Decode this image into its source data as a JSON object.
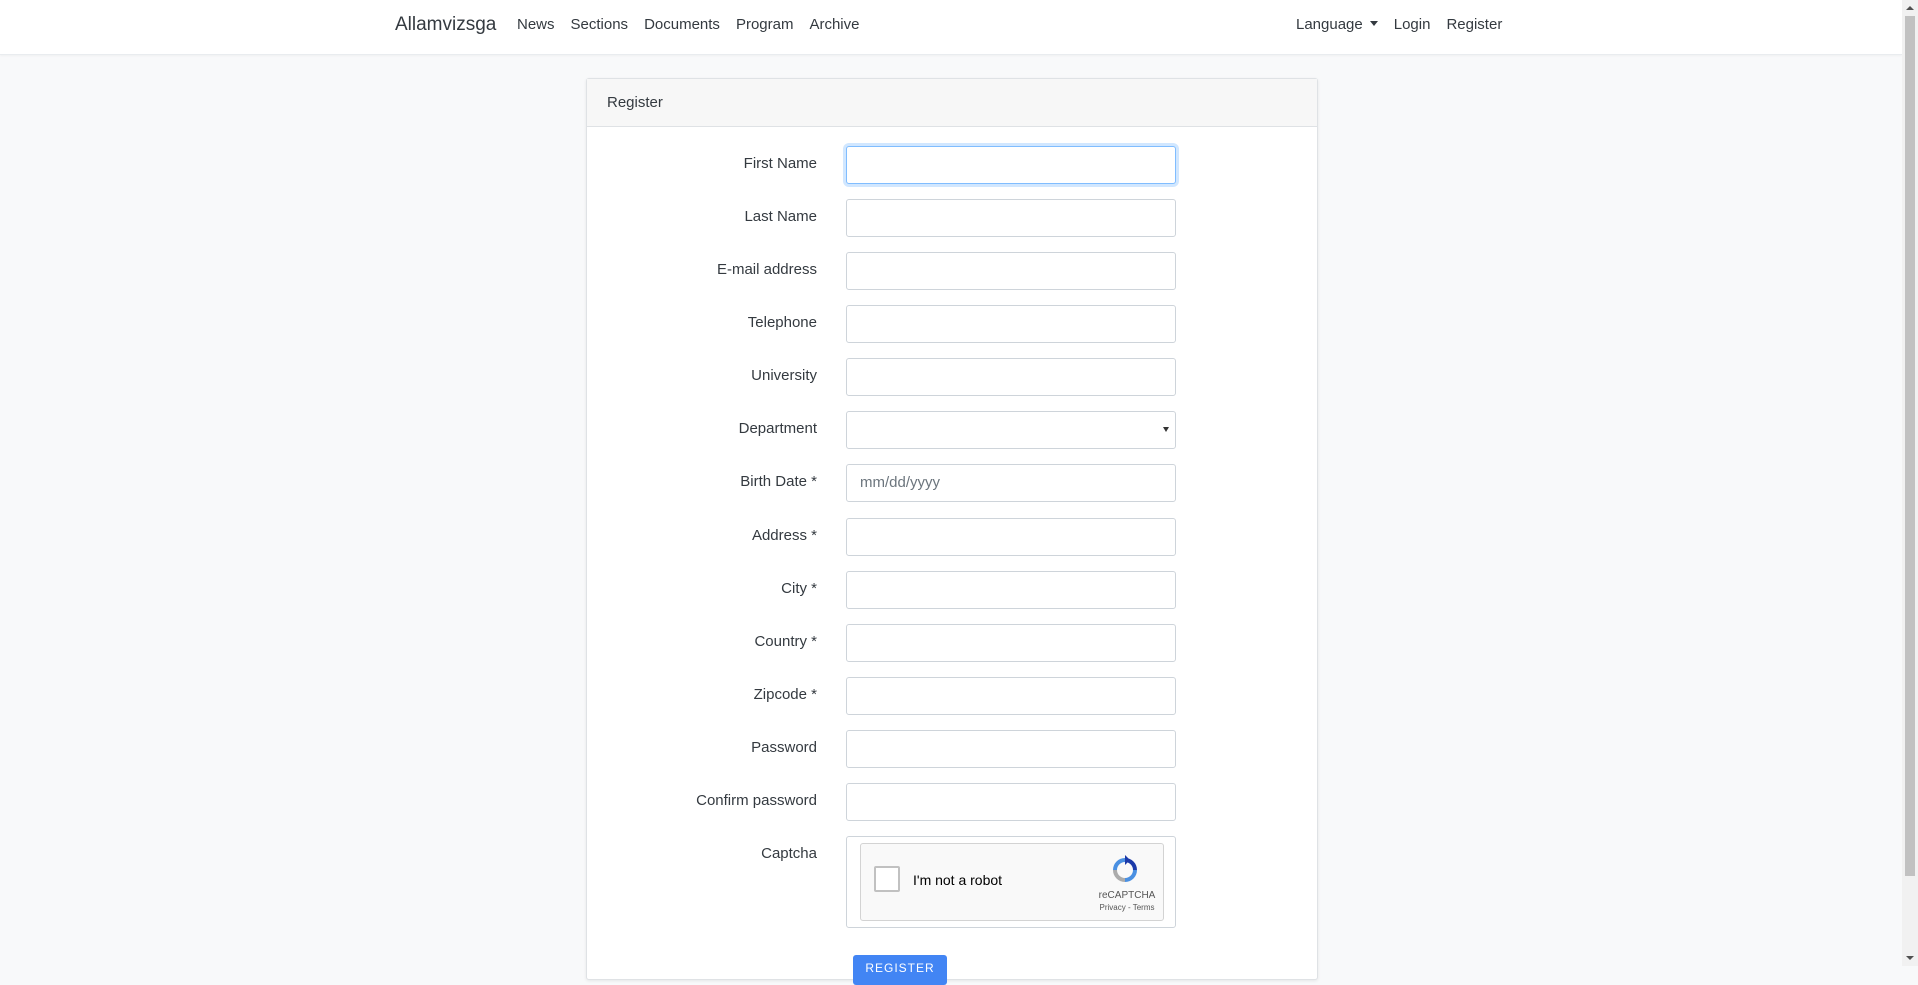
{
  "nav": {
    "brand": "Allamvizsga",
    "links": [
      "News",
      "Sections",
      "Documents",
      "Program",
      "Archive"
    ],
    "language": "Language",
    "login": "Login",
    "register": "Register"
  },
  "card": {
    "title": "Register",
    "fields": [
      {
        "label": "First Name",
        "value": "",
        "placeholder": ""
      },
      {
        "label": "Last Name",
        "value": "",
        "placeholder": ""
      },
      {
        "label": "E-mail address",
        "value": "",
        "placeholder": ""
      },
      {
        "label": "Telephone",
        "value": "",
        "placeholder": ""
      },
      {
        "label": "University",
        "value": "",
        "placeholder": ""
      },
      {
        "label": "Department",
        "value": "",
        "placeholder": ""
      },
      {
        "label": "Birth Date *",
        "value": "",
        "placeholder": "mm/dd/yyyy"
      },
      {
        "label": "Address *",
        "value": "",
        "placeholder": ""
      },
      {
        "label": "City *",
        "value": "",
        "placeholder": ""
      },
      {
        "label": "Country *",
        "value": "",
        "placeholder": ""
      },
      {
        "label": "Zipcode *",
        "value": "",
        "placeholder": ""
      },
      {
        "label": "Password",
        "value": "",
        "placeholder": ""
      },
      {
        "label": "Confirm password",
        "value": "",
        "placeholder": ""
      }
    ],
    "captcha": {
      "label": "Captcha",
      "checkbox_text": "I'm not a robot",
      "brand": "reCAPTCHA",
      "links": "Privacy - Terms"
    },
    "submit": "REGISTER"
  },
  "colors": {
    "accent": "#4285f4",
    "focus": "#80bdff",
    "background": "#f8f9fa"
  }
}
